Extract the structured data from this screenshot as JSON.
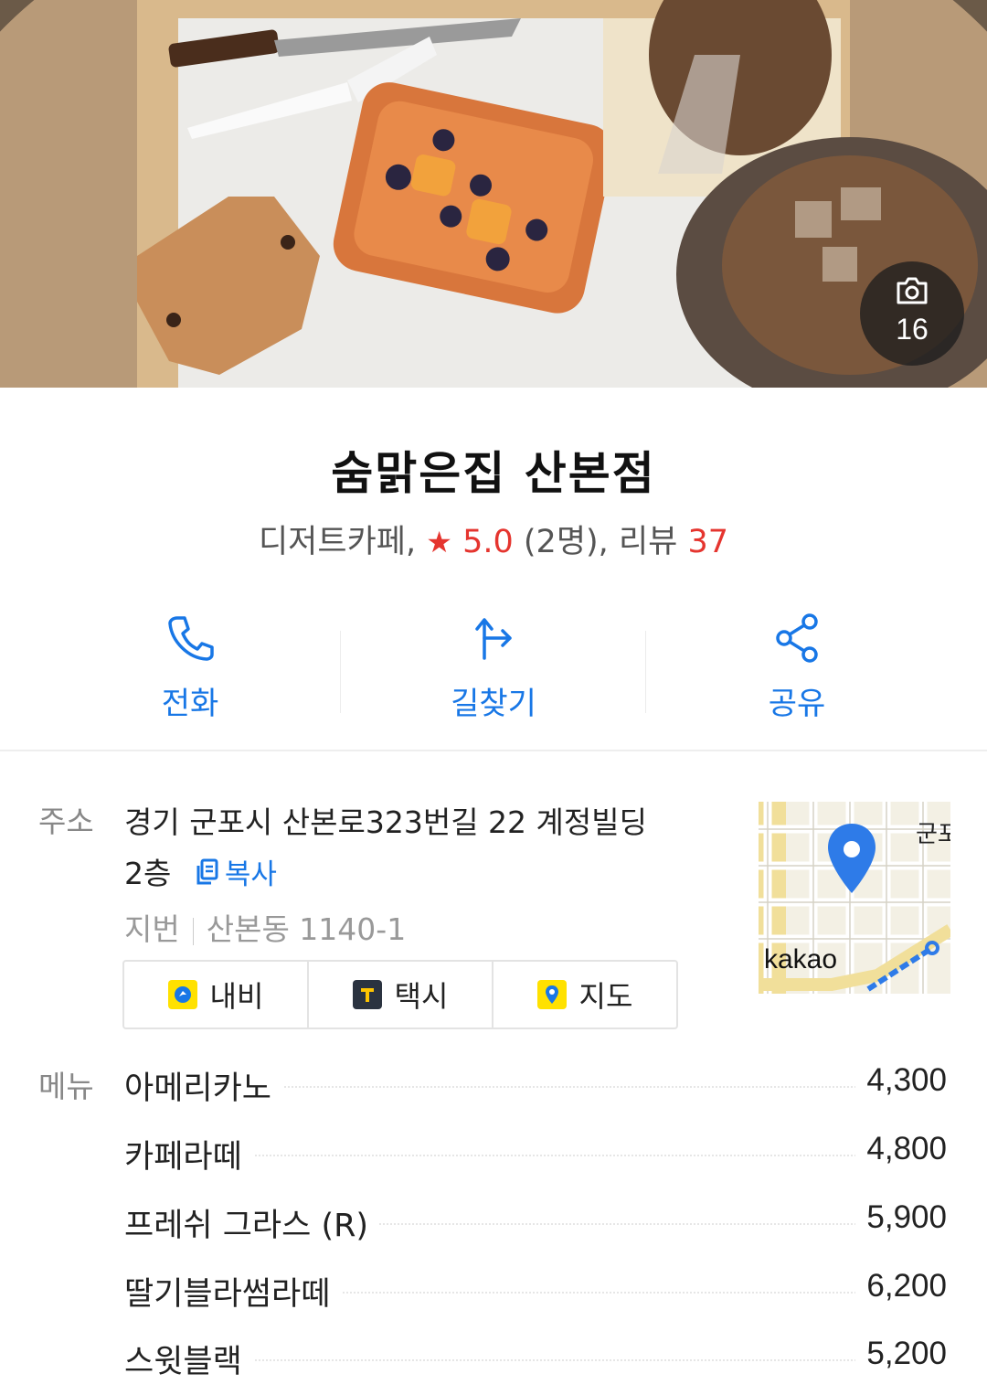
{
  "header": {
    "photo_count": "16"
  },
  "place": {
    "name": "숨맑은집 산본점",
    "category": "디저트카페,",
    "rating": "5.0",
    "rating_count": "(2명),",
    "review_label": "리뷰",
    "review_count": "37"
  },
  "actions": {
    "call": "전화",
    "directions": "길찾기",
    "share": "공유"
  },
  "address": {
    "label": "주소",
    "line1": "경기 군포시 산본로323번길 22 계정빌딩",
    "line2": "2층",
    "copy_label": "복사",
    "jibun_label": "지번",
    "jibun_value": "산본동 1140-1"
  },
  "nav_buttons": {
    "navi": "내비",
    "taxi": "택시",
    "map": "지도"
  },
  "map_thumb": {
    "brand": "kakao",
    "place_text": "군포"
  },
  "menu": {
    "label": "메뉴",
    "items": [
      {
        "name": "아메리카노",
        "price": "4,300"
      },
      {
        "name": "카페라떼",
        "price": "4,800"
      },
      {
        "name": "프레쉬 그라스 (R)",
        "price": "5,900"
      },
      {
        "name": "딸기블라썸라떼",
        "price": "6,200"
      },
      {
        "name": "스윗블랙",
        "price": "5,200"
      }
    ]
  },
  "colors": {
    "accent_blue": "#1877e6",
    "rating_red": "#e5352f"
  }
}
